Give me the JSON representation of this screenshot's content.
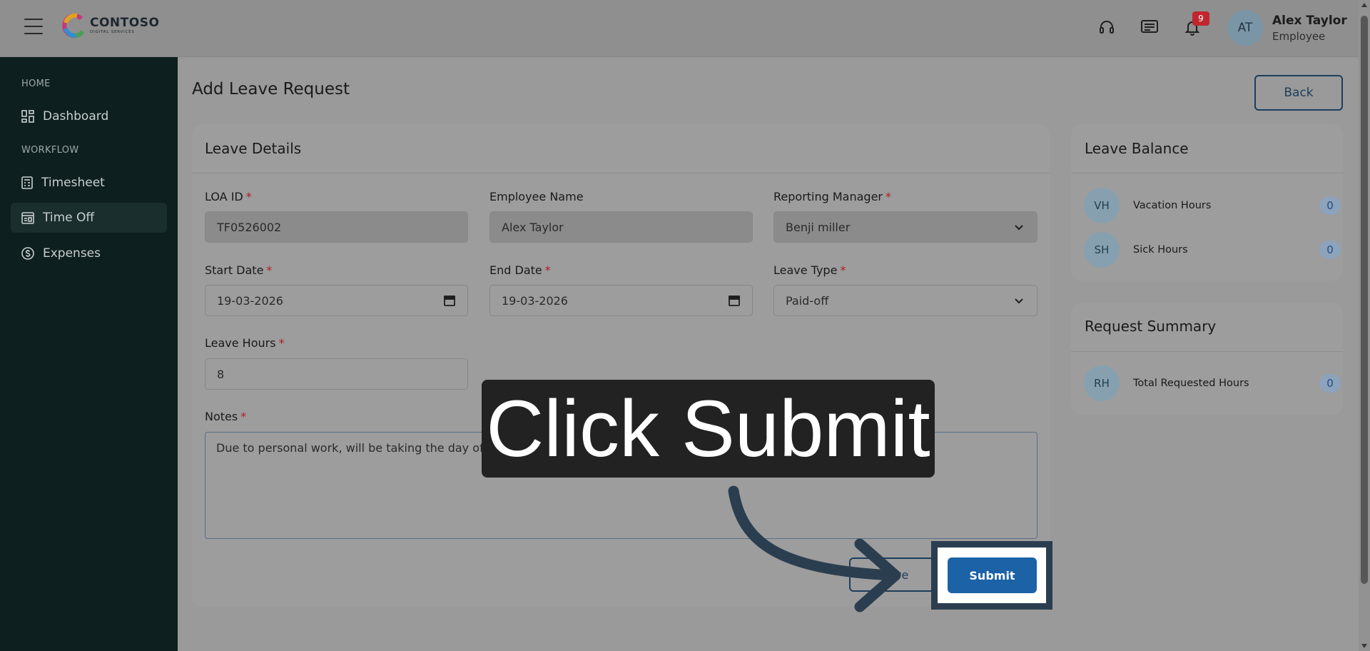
{
  "header": {
    "logo_name": "CONTOSO",
    "logo_sub": "DIGITAL SERVICES",
    "notification_count": "9",
    "user_initials": "AT",
    "user_name": "Alex Taylor",
    "user_role": "Employee",
    "icons": [
      "menu-icon",
      "headset-icon",
      "message-icon",
      "bell-icon"
    ]
  },
  "sidebar": {
    "sections": [
      {
        "label": "HOME",
        "items": [
          {
            "label": "Dashboard",
            "icon": "dashboard-icon"
          }
        ]
      },
      {
        "label": "WORKFLOW",
        "items": [
          {
            "label": "Timesheet",
            "icon": "timesheet-icon"
          },
          {
            "label": "Time Off",
            "icon": "calendar-icon",
            "active": true
          },
          {
            "label": "Expenses",
            "icon": "dollar-icon"
          }
        ]
      }
    ]
  },
  "page": {
    "title": "Add Leave Request",
    "back_label": "Back"
  },
  "leave_details": {
    "title": "Leave Details",
    "loa_id_label": "LOA ID",
    "loa_id_value": "TF0526002",
    "employee_name_label": "Employee Name",
    "employee_name_value": "Alex Taylor",
    "reporting_manager_label": "Reporting Manager",
    "reporting_manager_value": "Benji miller",
    "start_date_label": "Start Date",
    "start_date_value": "19-03-2026",
    "end_date_label": "End Date",
    "end_date_value": "19-03-2026",
    "leave_type_label": "Leave Type",
    "leave_type_value": "Paid-off",
    "leave_hours_label": "Leave Hours",
    "leave_hours_value": "8",
    "notes_label": "Notes",
    "notes_value": "Due to personal work, will be taking the day off",
    "required_mark": "*",
    "save_label_partial": "ve",
    "submit_label": "Submit"
  },
  "leave_balance": {
    "title": "Leave Balance",
    "rows": [
      {
        "code": "VH",
        "label": "Vacation Hours",
        "value": "0"
      },
      {
        "code": "SH",
        "label": "Sick Hours",
        "value": "0"
      }
    ]
  },
  "request_summary": {
    "title": "Request Summary",
    "rows": [
      {
        "code": "RH",
        "label": "Total Requested Hours",
        "value": "0"
      }
    ]
  },
  "tutorial": {
    "text": "Click Submit"
  },
  "colors": {
    "sidebar_bg": "#0d1f1f",
    "accent": "#1c62a6",
    "required": "#b01e1e",
    "badge": "#c0262f",
    "tooltip_bg": "#222222",
    "arrow": "#2b3e50"
  }
}
